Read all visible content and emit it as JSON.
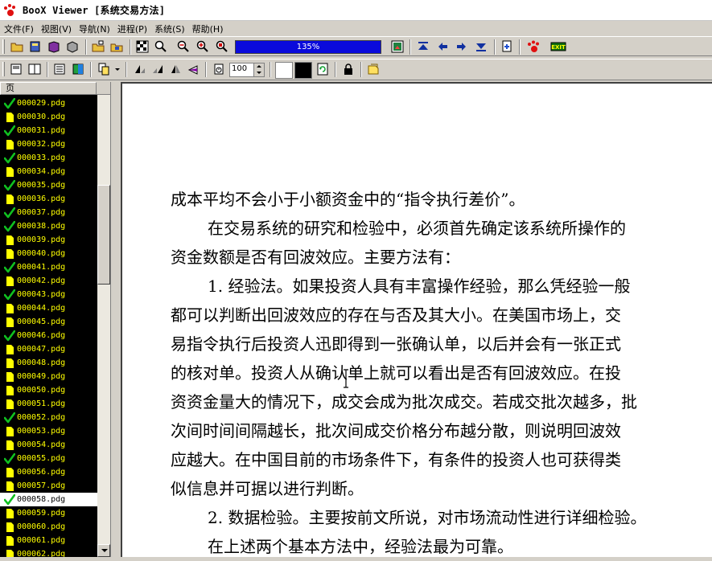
{
  "window": {
    "title": "BooX Viewer [系统交易方法]"
  },
  "menu": {
    "items": [
      "文件(F)",
      "视图(V)",
      "导航(N)",
      "进程(P)",
      "系统(S)",
      "帮助(H)"
    ]
  },
  "toolbar": {
    "zoom_label": "135%",
    "zoom_percent": 135,
    "spin_value": "100"
  },
  "sidebar": {
    "header": "页",
    "files": [
      {
        "name": "000029.pdg",
        "status": "check"
      },
      {
        "name": "000030.pdg",
        "status": "page"
      },
      {
        "name": "000031.pdg",
        "status": "check"
      },
      {
        "name": "000032.pdg",
        "status": "page"
      },
      {
        "name": "000033.pdg",
        "status": "check"
      },
      {
        "name": "000034.pdg",
        "status": "page"
      },
      {
        "name": "000035.pdg",
        "status": "check"
      },
      {
        "name": "000036.pdg",
        "status": "page"
      },
      {
        "name": "000037.pdg",
        "status": "check"
      },
      {
        "name": "000038.pdg",
        "status": "check"
      },
      {
        "name": "000039.pdg",
        "status": "page"
      },
      {
        "name": "000040.pdg",
        "status": "page"
      },
      {
        "name": "000041.pdg",
        "status": "check"
      },
      {
        "name": "000042.pdg",
        "status": "page"
      },
      {
        "name": "000043.pdg",
        "status": "check"
      },
      {
        "name": "000044.pdg",
        "status": "page"
      },
      {
        "name": "000045.pdg",
        "status": "page"
      },
      {
        "name": "000046.pdg",
        "status": "check"
      },
      {
        "name": "000047.pdg",
        "status": "page"
      },
      {
        "name": "000048.pdg",
        "status": "page"
      },
      {
        "name": "000049.pdg",
        "status": "page"
      },
      {
        "name": "000050.pdg",
        "status": "page"
      },
      {
        "name": "000051.pdg",
        "status": "page"
      },
      {
        "name": "000052.pdg",
        "status": "check"
      },
      {
        "name": "000053.pdg",
        "status": "page"
      },
      {
        "name": "000054.pdg",
        "status": "page"
      },
      {
        "name": "000055.pdg",
        "status": "check"
      },
      {
        "name": "000056.pdg",
        "status": "page"
      },
      {
        "name": "000057.pdg",
        "status": "page"
      },
      {
        "name": "000058.pdg",
        "status": "check",
        "selected": true
      },
      {
        "name": "000059.pdg",
        "status": "page"
      },
      {
        "name": "000060.pdg",
        "status": "page"
      },
      {
        "name": "000061.pdg",
        "status": "page"
      },
      {
        "name": "000062.pdg",
        "status": "page"
      }
    ]
  },
  "document": {
    "lines": [
      {
        "text": "成本平均不会小于小额资金中的“指令执行差价”。",
        "indent": false
      },
      {
        "text": "在交易系统的研究和检验中，必须首先确定该系统所操作的",
        "indent": true
      },
      {
        "text": "资金数额是否有回波效应。主要方法有：",
        "indent": false
      },
      {
        "text": "1. 经验法。如果投资人具有丰富操作经验，那么凭经验一般",
        "indent": true
      },
      {
        "text": "都可以判断出回波效应的存在与否及其大小。在美国市场上，交",
        "indent": false
      },
      {
        "text": "易指令执行后投资人迅即得到一张确认单，以后并会有一张正式",
        "indent": false
      },
      {
        "text": "的核对单。投资人从确认单上就可以看出是否有回波效应。在投",
        "indent": false
      },
      {
        "text": "资资金量大的情况下，成交会成为批次成交。若成交批次越多，批",
        "indent": false
      },
      {
        "text": "次间时间间隔越长，批次间成交价格分布越分散，则说明回波效",
        "indent": false
      },
      {
        "text": "应越大。在中国目前的市场条件下，有条件的投资人也可获得类",
        "indent": false
      },
      {
        "text": "似信息并可据以进行判断。",
        "indent": false
      },
      {
        "text": "2. 数据检验。主要按前文所说，对市场流动性进行详细检验。",
        "indent": true
      },
      {
        "text": "在上述两个基本方法中，经验法最为可靠。",
        "indent": true
      }
    ]
  },
  "colors": {
    "check": "#10c020",
    "file_text": "#ffff00",
    "zoom_bar": "#0a0adc"
  }
}
